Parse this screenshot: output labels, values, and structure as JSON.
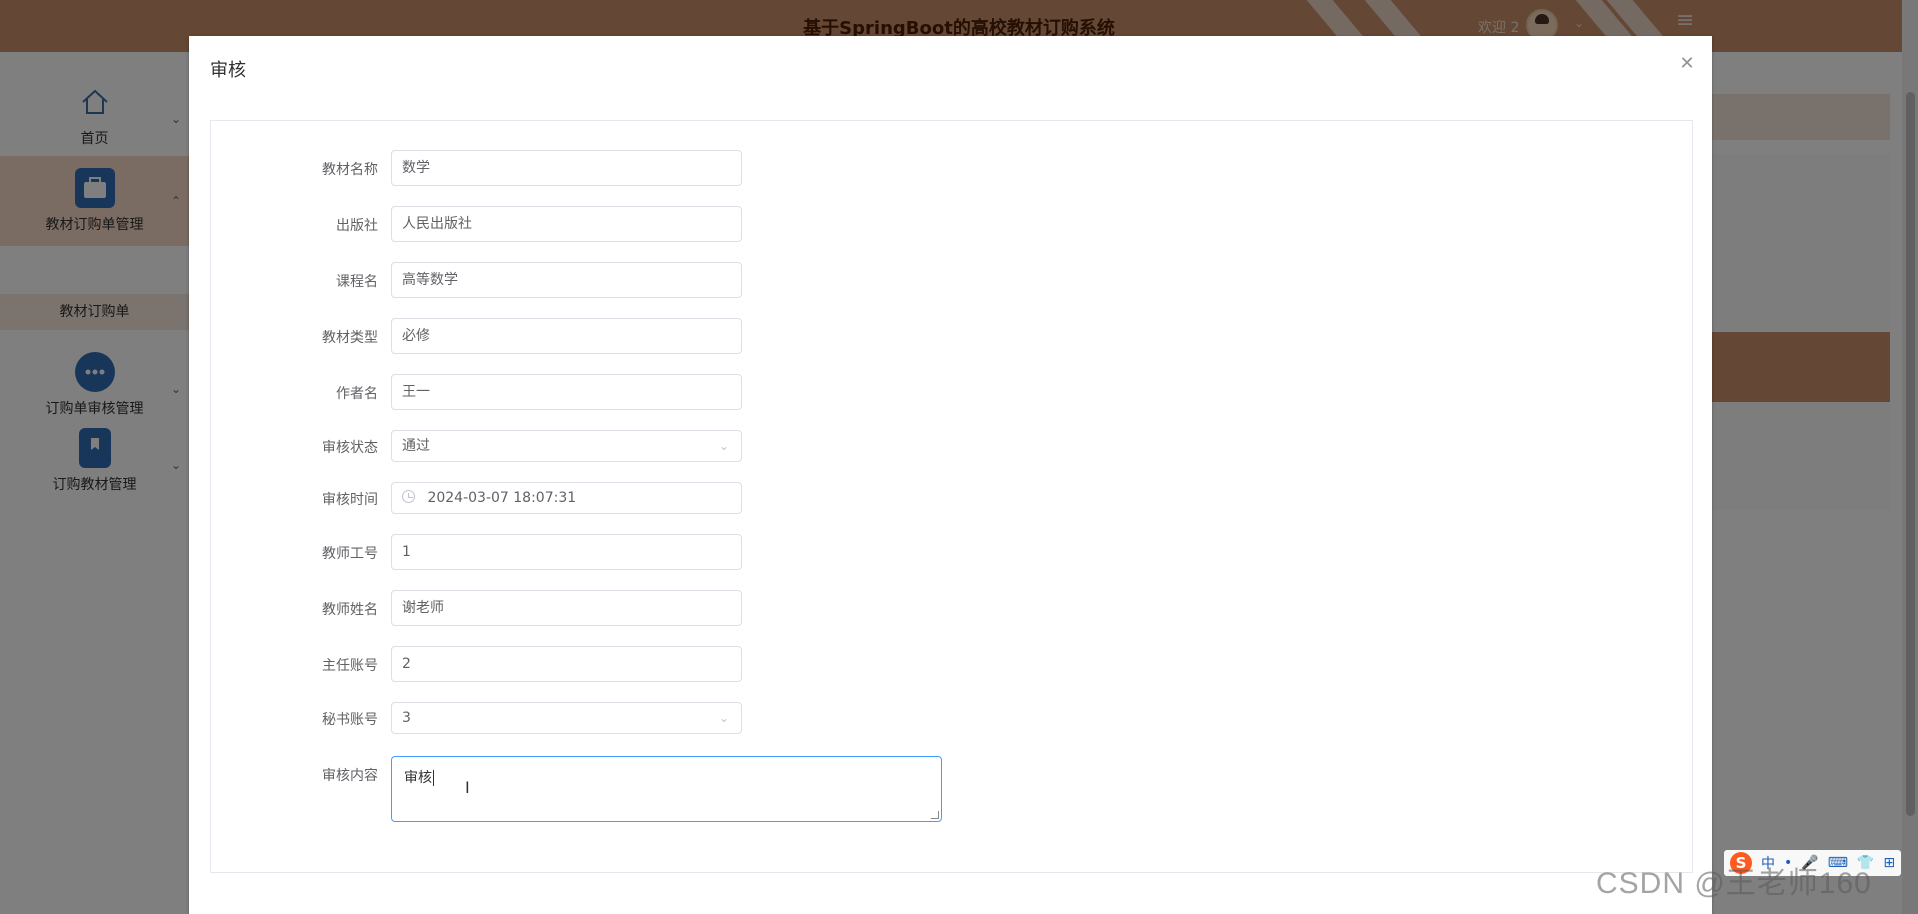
{
  "header": {
    "title": "基于SpringBoot的高校教材订购系统",
    "welcome": "欢迎 2",
    "accent_color": "#c98f68"
  },
  "sidebar": {
    "items": [
      {
        "label": "首页",
        "icon": "home-icon"
      },
      {
        "label": "教材订购单管理",
        "icon": "briefcase-icon"
      },
      {
        "label": "订购单审核管理",
        "icon": "dots-circle-icon"
      },
      {
        "label": "订购教材管理",
        "icon": "bookmark-book-icon"
      }
    ],
    "sub_item": "教材订购单"
  },
  "dialog": {
    "title": "审核",
    "close_icon": "close-icon",
    "fields": [
      {
        "label": "教材名称",
        "value": "数学"
      },
      {
        "label": "出版社",
        "value": "人民出版社"
      },
      {
        "label": "课程名",
        "value": "高等数学"
      },
      {
        "label": "教材类型",
        "value": "必修"
      },
      {
        "label": "作者名",
        "value": "王一"
      },
      {
        "label": "审核状态",
        "value": "通过"
      },
      {
        "label": "审核时间",
        "value": "2024-03-07 18:07:31"
      },
      {
        "label": "教师工号",
        "value": "1"
      },
      {
        "label": "教师姓名",
        "value": "谢老师"
      },
      {
        "label": "主任账号",
        "value": "2"
      },
      {
        "label": "秘书账号",
        "value": "3"
      },
      {
        "label": "审核内容",
        "value": "审核"
      }
    ]
  },
  "ime": {
    "logo": "S",
    "items": [
      "中",
      "•",
      "🎤",
      "⌨",
      "👕",
      "⊞"
    ]
  },
  "watermark": "CSDN @王老师160"
}
